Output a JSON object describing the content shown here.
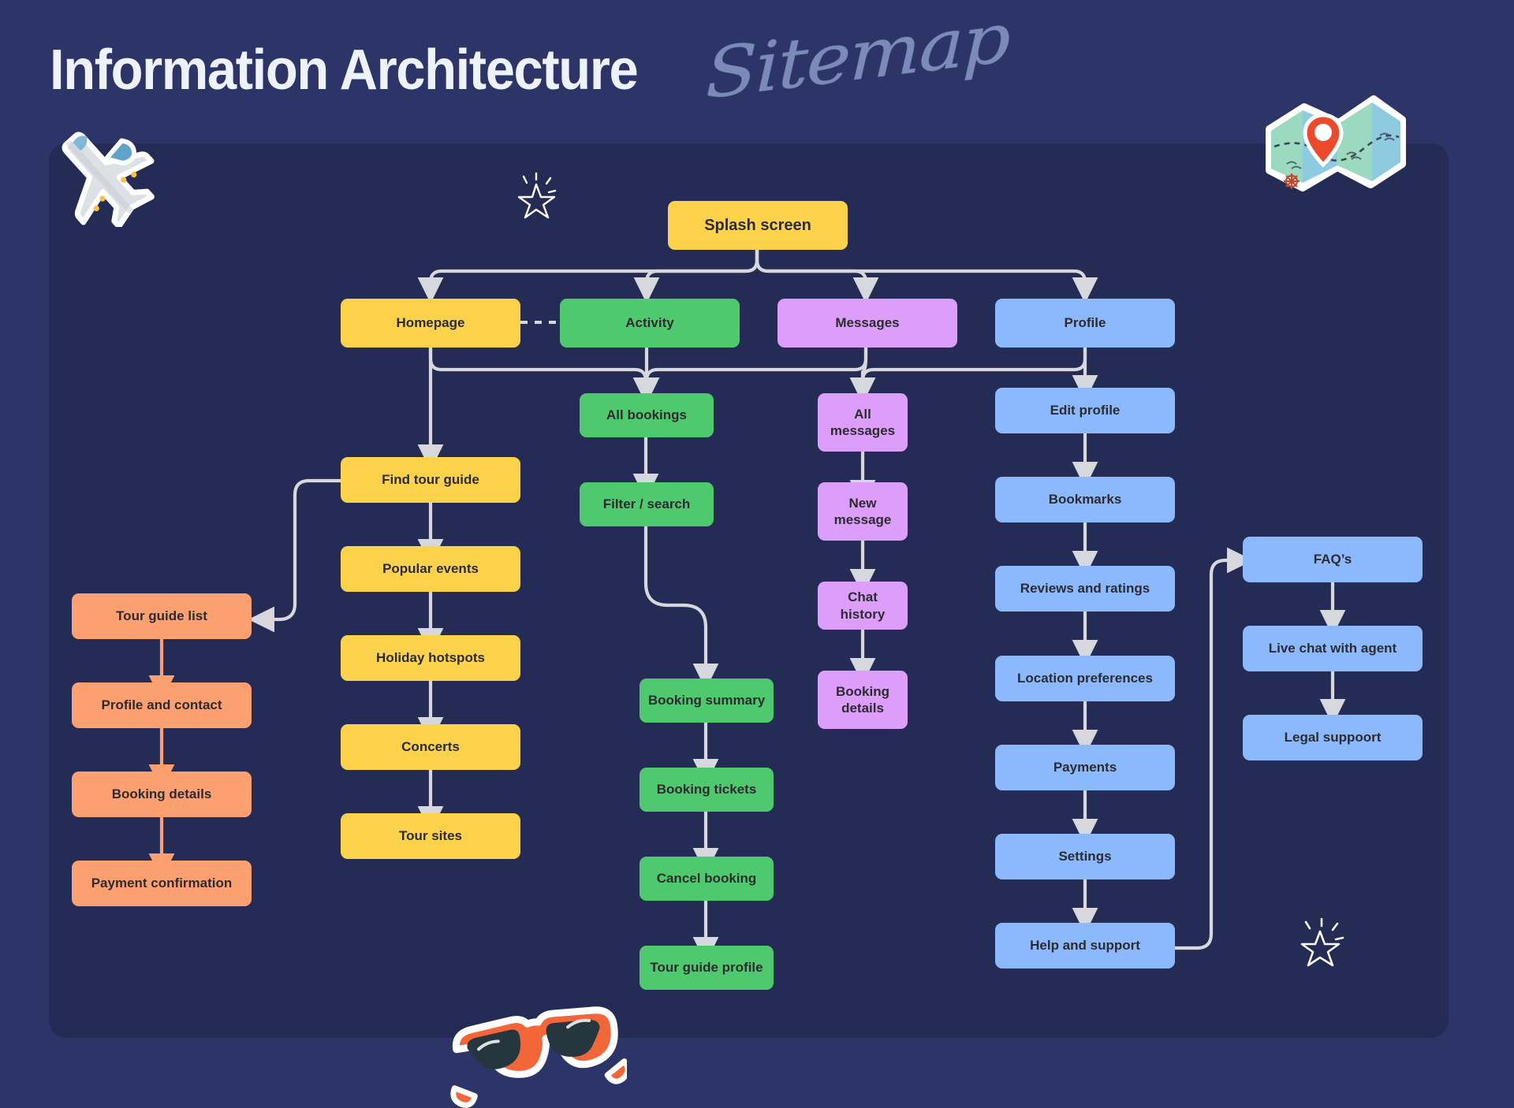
{
  "header": {
    "title": "Information Architecture",
    "script_word": "Sitemap"
  },
  "colors": {
    "background": "#2C3468",
    "panel": "#242B55",
    "yellow": "#FCD24A",
    "green": "#4FC96E",
    "purple": "#DD9DFB",
    "blue": "#8CB8FD",
    "orange": "#FCA071",
    "connector": "#D6D8DD",
    "connector_orange": "#FCA071",
    "node_text": "#2C2C30",
    "title_text": "#EEF2FC",
    "script_text": "#8A9AC8"
  },
  "chart_data": {
    "type": "diagram",
    "title": "Information Architecture Sitemap",
    "root": "Splash screen",
    "nodes": [
      {
        "id": "splash",
        "label": "Splash screen",
        "color": "yellow",
        "level": 0
      },
      {
        "id": "homepage",
        "label": "Homepage",
        "color": "yellow",
        "level": 1
      },
      {
        "id": "activity",
        "label": "Activity",
        "color": "green",
        "level": 1
      },
      {
        "id": "messages",
        "label": "Messages",
        "color": "purple",
        "level": 1
      },
      {
        "id": "profile",
        "label": "Profile",
        "color": "blue",
        "level": 1
      },
      {
        "id": "find-tour-guide",
        "label": "Find tour guide",
        "color": "yellow",
        "level": 2
      },
      {
        "id": "popular-events",
        "label": "Popular events",
        "color": "yellow",
        "level": 3
      },
      {
        "id": "holiday-hotspots",
        "label": "Holiday hotspots",
        "color": "yellow",
        "level": 4
      },
      {
        "id": "concerts",
        "label": "Concerts",
        "color": "yellow",
        "level": 5
      },
      {
        "id": "tour-sites",
        "label": "Tour sites",
        "color": "yellow",
        "level": 6
      },
      {
        "id": "tour-guide-list",
        "label": "Tour guide list",
        "color": "orange",
        "level": 3
      },
      {
        "id": "profile-and-contact",
        "label": "Profile and contact",
        "color": "orange",
        "level": 4
      },
      {
        "id": "booking-details-o",
        "label": "Booking details",
        "color": "orange",
        "level": 5
      },
      {
        "id": "payment-confirmation",
        "label": "Payment confirmation",
        "color": "orange",
        "level": 6
      },
      {
        "id": "all-bookings",
        "label": "All bookings",
        "color": "green",
        "level": 2
      },
      {
        "id": "filter-search",
        "label": "Filter / search",
        "color": "green",
        "level": 3
      },
      {
        "id": "booking-summary",
        "label": "Booking summary",
        "color": "green",
        "level": 4
      },
      {
        "id": "booking-tickets",
        "label": "Booking tickets",
        "color": "green",
        "level": 5
      },
      {
        "id": "cancel-booking",
        "label": "Cancel booking",
        "color": "green",
        "level": 6
      },
      {
        "id": "tour-guide-profile",
        "label": "Tour guide profile",
        "color": "green",
        "level": 7
      },
      {
        "id": "all-messages",
        "label": "All messages",
        "color": "purple",
        "level": 2
      },
      {
        "id": "new-message",
        "label": "New message",
        "color": "purple",
        "level": 3
      },
      {
        "id": "chat-history",
        "label": "Chat history",
        "color": "purple",
        "level": 4
      },
      {
        "id": "booking-details-p",
        "label": "Booking details",
        "color": "purple",
        "level": 5
      },
      {
        "id": "edit-profile",
        "label": "Edit profile",
        "color": "blue",
        "level": 2
      },
      {
        "id": "bookmarks",
        "label": "Bookmarks",
        "color": "blue",
        "level": 3
      },
      {
        "id": "reviews-and-ratings",
        "label": "Reviews and ratings",
        "color": "blue",
        "level": 4
      },
      {
        "id": "location-preferences",
        "label": "Location preferences",
        "color": "blue",
        "level": 5
      },
      {
        "id": "payments",
        "label": "Payments",
        "color": "blue",
        "level": 6
      },
      {
        "id": "settings",
        "label": "Settings",
        "color": "blue",
        "level": 7
      },
      {
        "id": "help-and-support",
        "label": "Help and support",
        "color": "blue",
        "level": 8
      },
      {
        "id": "faqs",
        "label": "FAQ’s",
        "color": "blue",
        "level": 4
      },
      {
        "id": "live-chat-with-agent",
        "label": "Live chat with agent",
        "color": "blue",
        "level": 5
      },
      {
        "id": "legal-suppoort",
        "label": "Legal suppoort",
        "color": "blue",
        "level": 6
      }
    ],
    "edges": [
      {
        "from": "splash",
        "to": "homepage",
        "style": "solid"
      },
      {
        "from": "splash",
        "to": "activity",
        "style": "solid"
      },
      {
        "from": "splash",
        "to": "messages",
        "style": "solid"
      },
      {
        "from": "splash",
        "to": "profile",
        "style": "solid"
      },
      {
        "from": "homepage",
        "to": "activity",
        "style": "dashed"
      },
      {
        "from": "homepage",
        "to": "find-tour-guide",
        "style": "solid"
      },
      {
        "from": "homepage",
        "to": "all-bookings",
        "style": "solid"
      },
      {
        "from": "activity",
        "to": "all-bookings",
        "style": "solid"
      },
      {
        "from": "messages",
        "to": "all-messages",
        "style": "solid"
      },
      {
        "from": "messages",
        "to": "all-bookings",
        "style": "solid"
      },
      {
        "from": "profile",
        "to": "edit-profile",
        "style": "solid"
      },
      {
        "from": "profile",
        "to": "all-messages",
        "style": "solid"
      },
      {
        "from": "find-tour-guide",
        "to": "popular-events",
        "style": "solid"
      },
      {
        "from": "popular-events",
        "to": "holiday-hotspots",
        "style": "solid"
      },
      {
        "from": "holiday-hotspots",
        "to": "concerts",
        "style": "solid"
      },
      {
        "from": "concerts",
        "to": "tour-sites",
        "style": "solid"
      },
      {
        "from": "find-tour-guide",
        "to": "tour-guide-list",
        "style": "solid"
      },
      {
        "from": "tour-guide-list",
        "to": "profile-and-contact",
        "style": "solid"
      },
      {
        "from": "profile-and-contact",
        "to": "booking-details-o",
        "style": "solid"
      },
      {
        "from": "booking-details-o",
        "to": "payment-confirmation",
        "style": "solid"
      },
      {
        "from": "all-bookings",
        "to": "filter-search",
        "style": "solid"
      },
      {
        "from": "filter-search",
        "to": "booking-summary",
        "style": "solid"
      },
      {
        "from": "booking-summary",
        "to": "booking-tickets",
        "style": "solid"
      },
      {
        "from": "booking-tickets",
        "to": "cancel-booking",
        "style": "solid"
      },
      {
        "from": "cancel-booking",
        "to": "tour-guide-profile",
        "style": "solid"
      },
      {
        "from": "all-messages",
        "to": "new-message",
        "style": "solid"
      },
      {
        "from": "new-message",
        "to": "chat-history",
        "style": "solid"
      },
      {
        "from": "chat-history",
        "to": "booking-details-p",
        "style": "solid"
      },
      {
        "from": "edit-profile",
        "to": "bookmarks",
        "style": "solid"
      },
      {
        "from": "bookmarks",
        "to": "reviews-and-ratings",
        "style": "solid"
      },
      {
        "from": "reviews-and-ratings",
        "to": "location-preferences",
        "style": "solid"
      },
      {
        "from": "location-preferences",
        "to": "payments",
        "style": "solid"
      },
      {
        "from": "payments",
        "to": "settings",
        "style": "solid"
      },
      {
        "from": "settings",
        "to": "help-and-support",
        "style": "solid"
      },
      {
        "from": "help-and-support",
        "to": "faqs",
        "style": "solid"
      },
      {
        "from": "faqs",
        "to": "live-chat-with-agent",
        "style": "solid"
      },
      {
        "from": "live-chat-with-agent",
        "to": "legal-suppoort",
        "style": "solid"
      }
    ]
  },
  "decorations": [
    {
      "name": "airplane-sticker",
      "kind": "sticker"
    },
    {
      "name": "folded-map-sticker",
      "kind": "sticker"
    },
    {
      "name": "sunglasses-sticker",
      "kind": "sticker"
    },
    {
      "name": "sparkle-star",
      "kind": "sparkle"
    },
    {
      "name": "sparkle-star",
      "kind": "sparkle"
    }
  ]
}
